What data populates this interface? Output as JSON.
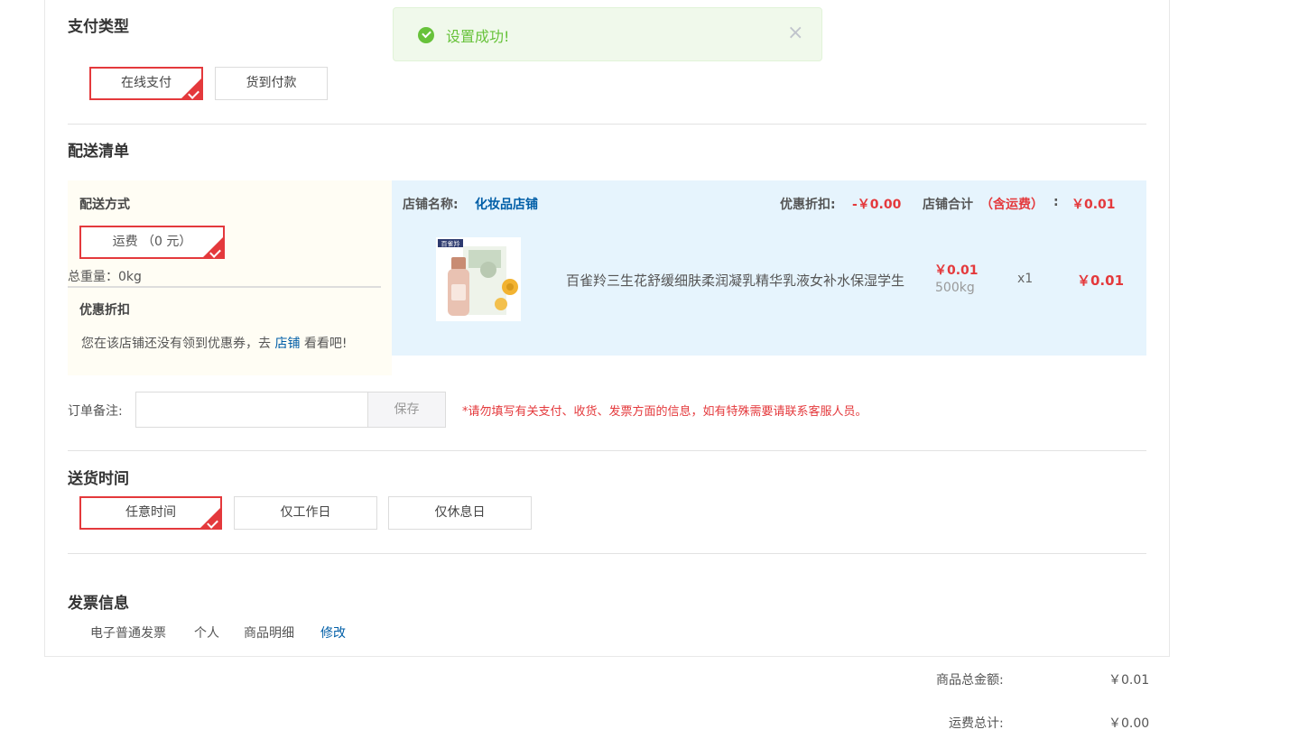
{
  "toast": {
    "message": "设置成功!",
    "close": "×"
  },
  "payment": {
    "title": "支付类型",
    "options": [
      "在线支付",
      "货到付款"
    ]
  },
  "delivery": {
    "title": "配送清单",
    "method_label": "配送方式",
    "fee_option": "运费 （0 元）",
    "weight": "总重量：0kg",
    "discount_title": "优惠折扣",
    "coupon_text_pre": "您在该店铺还没有领到优惠券，去",
    "coupon_link": "店铺",
    "coupon_text_post": "看看吧!"
  },
  "shop": {
    "name_label": "店铺名称:",
    "name": "化妆品店铺",
    "discount_label": "优惠折扣:",
    "discount_value": "-￥0.00",
    "total_label": "店铺合计",
    "total_note": "（含运费）",
    "total_colon": ":",
    "total_value": "￥0.01",
    "product": {
      "title": "百雀羚三生花舒缓细肤柔润凝乳精华乳液女补水保湿学生",
      "price": "￥0.01",
      "weight": "500kg",
      "qty": "x1",
      "subtotal": "￥0.01",
      "brand_text": "百雀羚"
    }
  },
  "remark": {
    "label": "订单备注:",
    "value": "",
    "placeholder": "",
    "save": "保存",
    "notice": "*请勿填写有关支付、收货、发票方面的信息，如有特殊需要请联系客服人员。"
  },
  "delivery_time": {
    "title": "送货时间",
    "options": [
      "任意时间",
      "仅工作日",
      "仅休息日"
    ]
  },
  "invoice": {
    "title": "发票信息",
    "type": "电子普通发票",
    "holder": "个人",
    "content": "商品明细",
    "edit": "修改"
  },
  "summary": {
    "goods_label": "商品总金额:",
    "goods_value": "￥0.01",
    "freight_label": "运费总计:",
    "freight_value": "￥0.00"
  },
  "colors": {
    "accent": "#e4393c",
    "link": "#005ea7",
    "success": "#67c23a"
  }
}
